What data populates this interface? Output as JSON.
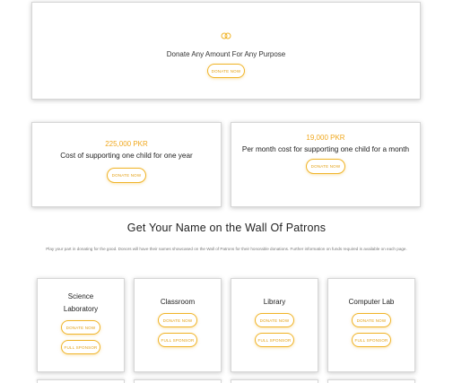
{
  "general_donation": {
    "icon": "rings-icon",
    "title": "Donate Any Amount For Any Purpose",
    "button": "DONATE NOW"
  },
  "sponsorships": [
    {
      "amount": "225,000 PKR",
      "text": "Cost of supporting one child for one year",
      "button": "DONATE NOW"
    },
    {
      "amount": "19,000 PKR",
      "text": "Per month cost for supporting one child for a month",
      "button": "DONATE NOW"
    }
  ],
  "wall": {
    "heading": "Get Your Name on the Wall Of Patrons",
    "description": "Play your part in donating for the good. Donors will have their names showcased on the Wall of Patrons for their honorable donations. Further information on funds required is available on each page."
  },
  "patrons": [
    {
      "title": "Science Laboratory",
      "donate": "DONATE NOW",
      "sponsor": "FULL SPONSOR"
    },
    {
      "title": "Classroom",
      "donate": "DONATE NOW",
      "sponsor": "FULL SPONSOR"
    },
    {
      "title": "Library",
      "donate": "DONATE NOW",
      "sponsor": "FULL SPONSOR"
    },
    {
      "title": "Computer Lab",
      "donate": "DONATE NOW",
      "sponsor": "FULL SPONSOR"
    }
  ],
  "colors": {
    "accent": "#f0b429",
    "text": "#222222",
    "border": "#d6d6d6"
  }
}
